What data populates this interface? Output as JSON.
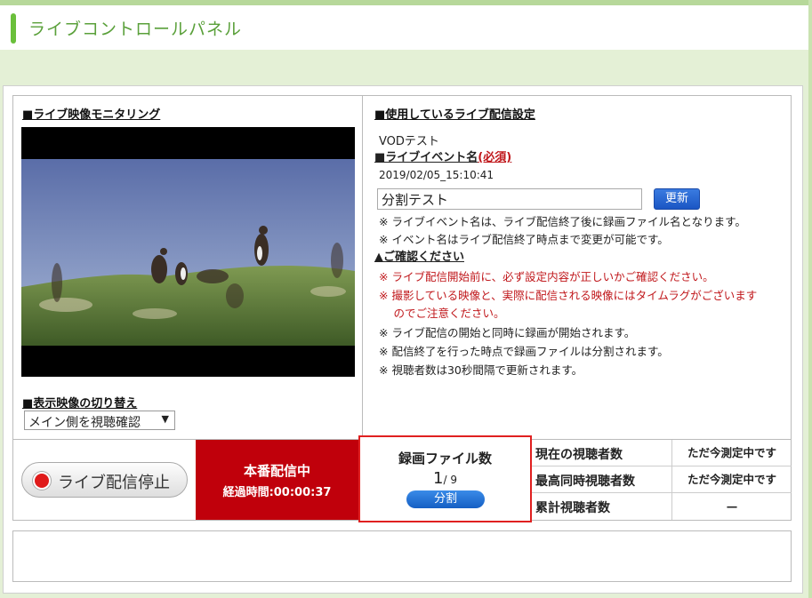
{
  "header": {
    "title": "ライブコントロールパネル"
  },
  "monitor": {
    "title": "■ライブ映像モニタリング",
    "switch_title": "■表示映像の切り替え",
    "switch_selected": "メイン側を視聴確認"
  },
  "settings": {
    "title": "■使用しているライブ配信設定",
    "name": "VODテスト",
    "event_title": "■ライブイベント名",
    "event_required": "(必須)",
    "timestamp": "2019/02/05_15:10:41",
    "event_value": "分割テスト",
    "update_label": "更新",
    "notes": [
      "※ ライブイベント名は、ライブ配信終了後に録画ファイル名となります。",
      "※ イベント名はライブ配信終了時点まで変更が可能です。"
    ],
    "confirm_title": "▲ご確認ください",
    "confirm_red": [
      "※ ライブ配信開始前に、必ず設定内容が正しいかご確認ください。",
      "※ 撮影している映像と、実際に配信される映像にはタイムラグがございます",
      "　 のでご注意ください。"
    ],
    "confirm_black": [
      "※ ライブ配信の開始と同時に録画が開始されます。",
      "※ 配信終了を行った時点で録画ファイルは分割されます。",
      "※ 視聴者数は30秒間隔で更新されます。"
    ]
  },
  "controls": {
    "stop_label": "ライブ配信停止",
    "live_status": "本番配信中",
    "elapsed": "経過時間:00:00:37"
  },
  "recording": {
    "title": "録画ファイル数",
    "current": "1",
    "total": "/ 9",
    "split_label": "分割"
  },
  "stats": [
    {
      "label": "現在の視聴者数",
      "value": "ただ今測定中です"
    },
    {
      "label": "最高同時視聴者数",
      "value": "ただ今測定中です"
    },
    {
      "label": "累計視聴者数",
      "value": "—"
    }
  ],
  "colors": {
    "accent": "#6abf3b",
    "live": "#c0000b",
    "button": "#1b56c4",
    "warning": "#c0171b"
  }
}
